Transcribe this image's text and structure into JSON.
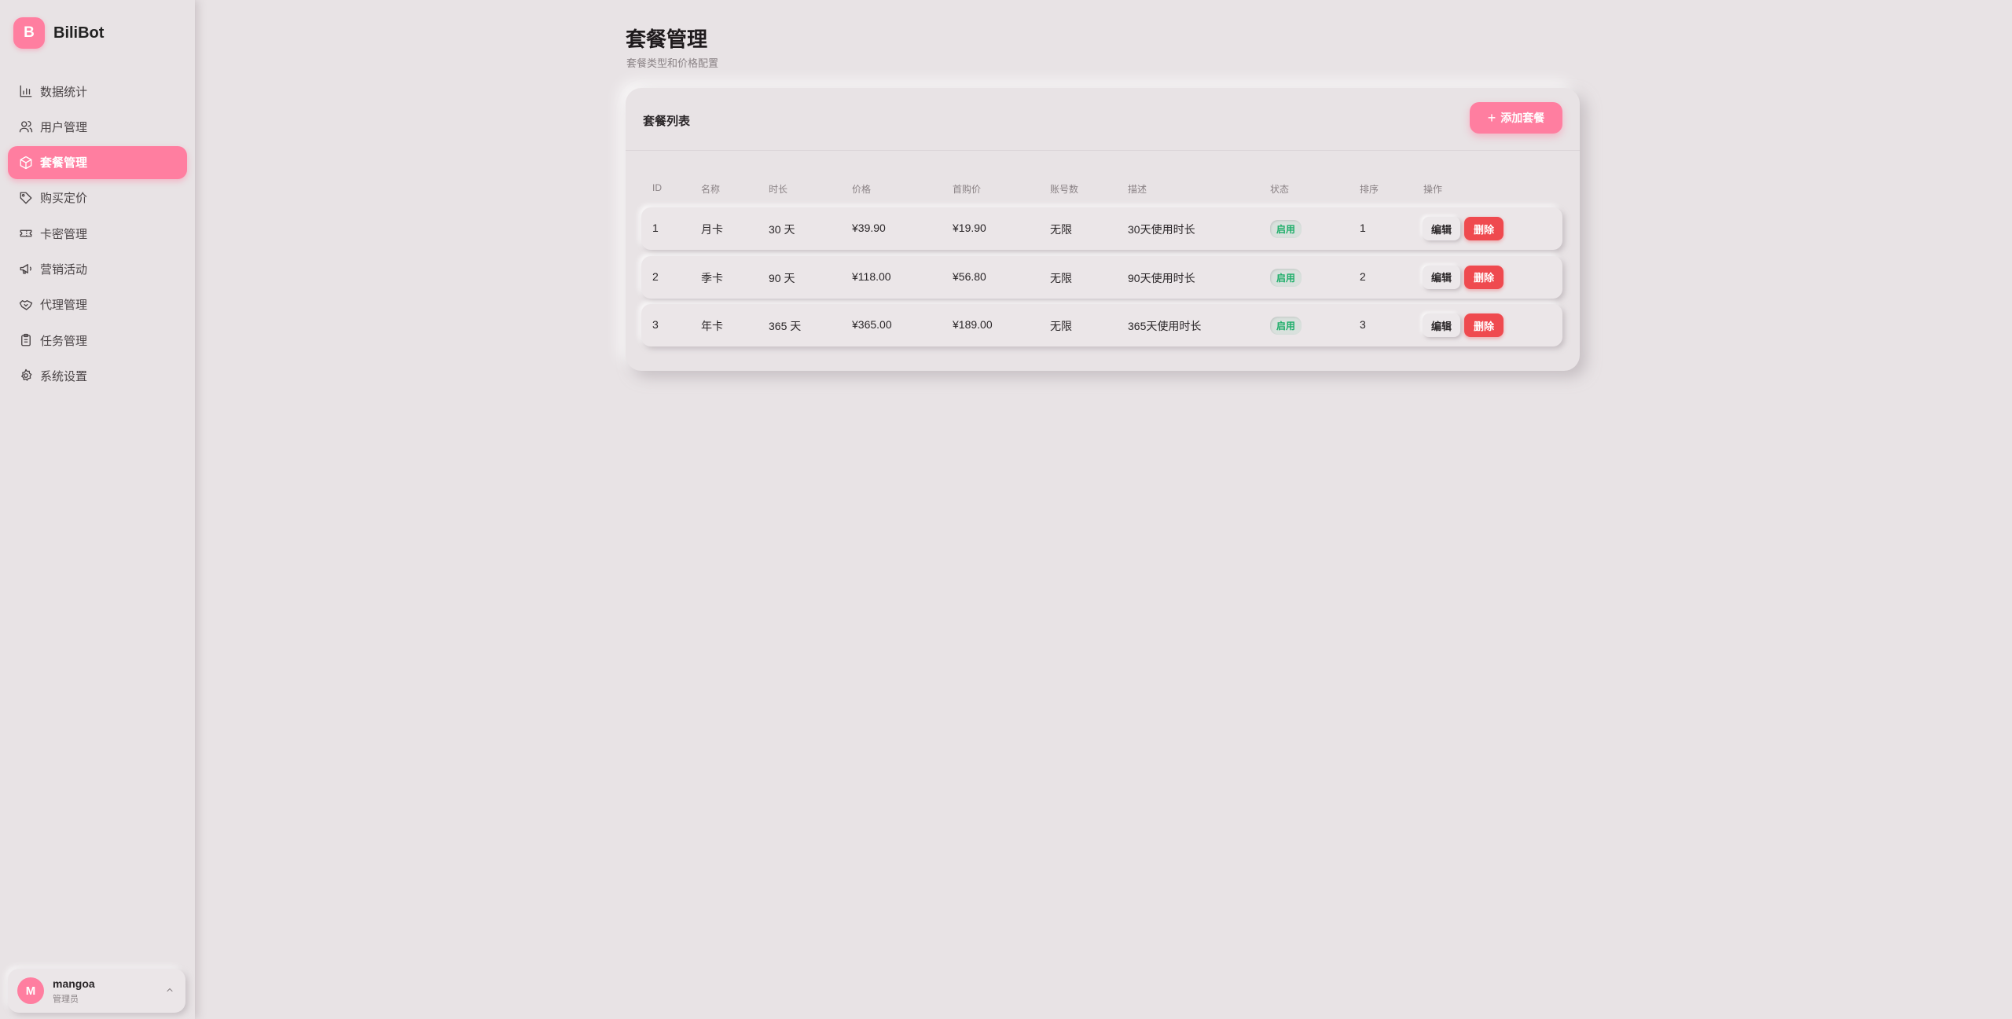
{
  "brand": {
    "logo_letter": "B",
    "name": "BiliBot"
  },
  "sidebar": {
    "items": [
      {
        "label": "数据统计",
        "icon": "bar-chart-icon"
      },
      {
        "label": "用户管理",
        "icon": "users-icon"
      },
      {
        "label": "套餐管理",
        "icon": "package-icon",
        "active": true
      },
      {
        "label": "购买定价",
        "icon": "tag-icon"
      },
      {
        "label": "卡密管理",
        "icon": "ticket-icon"
      },
      {
        "label": "营销活动",
        "icon": "megaphone-icon"
      },
      {
        "label": "代理管理",
        "icon": "handshake-icon"
      },
      {
        "label": "任务管理",
        "icon": "clipboard-icon"
      },
      {
        "label": "系统设置",
        "icon": "gear-icon"
      }
    ]
  },
  "user": {
    "avatar_letter": "M",
    "name": "mangoa",
    "role": "管理员"
  },
  "page": {
    "title": "套餐管理",
    "subtitle": "套餐类型和价格配置"
  },
  "card": {
    "title": "套餐列表",
    "add_button": "添加套餐"
  },
  "table": {
    "headers": {
      "id": "ID",
      "name": "名称",
      "duration": "时长",
      "price": "价格",
      "first_price": "首购价",
      "accounts": "账号数",
      "desc": "描述",
      "status": "状态",
      "sort": "排序",
      "ops": "操作"
    },
    "rows": [
      {
        "id": "1",
        "name": "月卡",
        "duration": "30 天",
        "price": "¥39.90",
        "first_price": "¥19.90",
        "accounts": "无限",
        "desc": "30天使用时长",
        "status": "启用",
        "sort": "1"
      },
      {
        "id": "2",
        "name": "季卡",
        "duration": "90 天",
        "price": "¥118.00",
        "first_price": "¥56.80",
        "accounts": "无限",
        "desc": "90天使用时长",
        "status": "启用",
        "sort": "2"
      },
      {
        "id": "3",
        "name": "年卡",
        "duration": "365 天",
        "price": "¥365.00",
        "first_price": "¥189.00",
        "accounts": "无限",
        "desc": "365天使用时长",
        "status": "启用",
        "sort": "3"
      }
    ],
    "edit_label": "编辑",
    "delete_label": "删除"
  },
  "colors": {
    "accent": "#ff7ea0",
    "danger": "#ef4a4f",
    "success": "#1fae6a",
    "background": "#e8e3e5"
  }
}
